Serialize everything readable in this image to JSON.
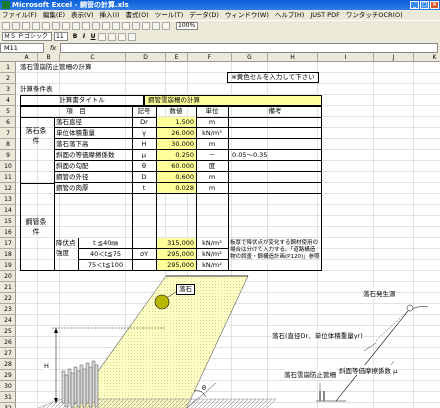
{
  "window": {
    "title": "Microsoft Excel - 鋼管の計算.xls"
  },
  "menu": [
    "ファイル(F)",
    "編集(E)",
    "表示(V)",
    "挿入(I)",
    "書式(O)",
    "ツール(T)",
    "データ(D)",
    "ウィンドウ(W)",
    "ヘルプ(H)",
    "JUST PDF",
    "ワンタッチOCR(O)"
  ],
  "toolbar": {
    "zoom": "100%"
  },
  "format": {
    "font": "ＭＳ Ｐゴシック",
    "size": "11"
  },
  "formula": {
    "cell_ref": "M11",
    "content": ""
  },
  "columns": [
    "A",
    "B",
    "C",
    "D",
    "E",
    "F",
    "G",
    "H",
    "I",
    "J",
    "K"
  ],
  "rows": [
    "1",
    "2",
    "3",
    "4",
    "5",
    "6",
    "7",
    "8",
    "9",
    "10",
    "11",
    "12",
    "13",
    "14",
    "15",
    "16",
    "17",
    "18",
    "19",
    "20",
    "21",
    "22",
    "23",
    "24",
    "25",
    "26",
    "27",
    "28",
    "29",
    "30",
    "31",
    "32",
    "33"
  ],
  "sheet": {
    "title": "落石雪崩防止管柵の計算",
    "note": "※黄色セルを入力して下さい",
    "section": "計算条件表",
    "calc_title_label": "計算書タイトル",
    "calc_title_value": "鋼管雪崩柵の計算",
    "headers": {
      "item": "項　目",
      "symbol": "記号",
      "value": "数値",
      "unit": "単位",
      "remark": "備考"
    },
    "group1": "落石条件",
    "group2": "鋼管条件",
    "strength_label": "降伏点強度",
    "rows": [
      {
        "item": "落石直径",
        "symbol": "Dr",
        "value": "1.500",
        "unit": "m",
        "remark": ""
      },
      {
        "item": "単位体積重量",
        "symbol": "γ",
        "value": "26.000",
        "unit": "kN/m³",
        "remark": ""
      },
      {
        "item": "落石落下高",
        "symbol": "H",
        "value": "30.000",
        "unit": "m",
        "remark": ""
      },
      {
        "item": "斜面の等価摩擦係数",
        "symbol": "μ",
        "value": "0.250",
        "unit": "－",
        "remark": "0.05～0.35"
      },
      {
        "item": "斜面の勾配",
        "symbol": "θ",
        "value": "60.000",
        "unit": "度",
        "remark": ""
      },
      {
        "item": "鋼管の外径",
        "symbol": "D",
        "value": "0.600",
        "unit": "m",
        "remark": ""
      },
      {
        "item": "鋼管の肉厚",
        "symbol": "t",
        "value": "0.028",
        "unit": "m",
        "remark": ""
      }
    ],
    "strength": [
      {
        "cond": "t ≦40㎜",
        "value": "315,000",
        "unit": "kN/m²"
      },
      {
        "cond": "40＜t≦75",
        "value": "295,000",
        "unit": "kN/m²"
      },
      {
        "cond": "75＜t≦100",
        "value": "295,000",
        "unit": "kN/m²"
      }
    ],
    "strength_symbol": "σY",
    "strength_remark": "板厚で降伏点が変化する鋼材使用の場合は分けて入力する。「道路構造物の調査・鋼構造計画(P120)」参照"
  },
  "diagram": {
    "label_rock": "落石",
    "label_rock_source": "落石発生源",
    "label_rock_props": "落石(直径Dr、単位体積重量γr)",
    "label_pipe": "落石雪崩防止管柵",
    "label_friction": "斜面等価摩擦係数 μ",
    "label_H": "H",
    "label_theta": "θ"
  }
}
